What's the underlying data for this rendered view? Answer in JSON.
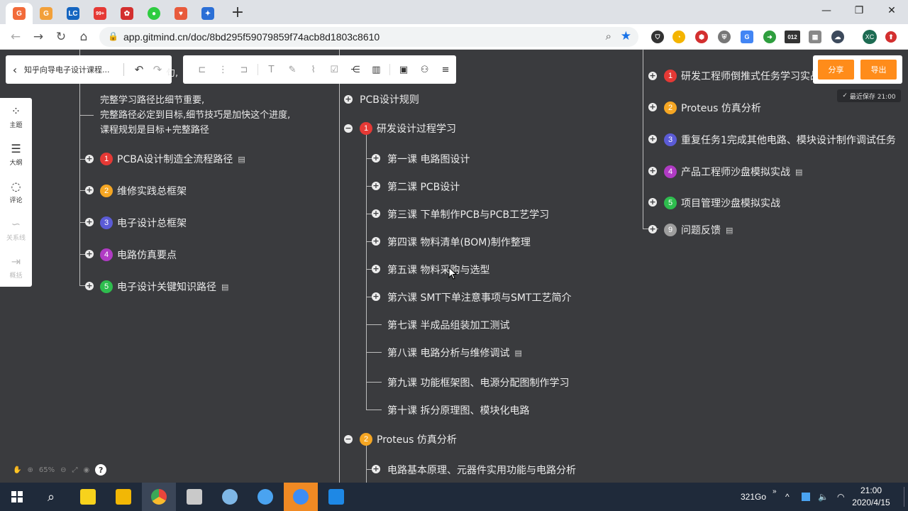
{
  "browser": {
    "tabs": [
      {
        "icon": "gitmind-icon",
        "color": "#f26b3a",
        "text": "",
        "active": true
      },
      {
        "icon": "gitmind-icon",
        "color": "#f2a03a",
        "text": "",
        "active": false
      },
      {
        "icon": "leetcode-icon",
        "color": "#1565c0",
        "text": "LC",
        "active": false
      },
      {
        "icon": "app-99-icon",
        "color": "#e53935",
        "text": "99+",
        "active": false
      },
      {
        "icon": "octopus-icon",
        "color": "#d32f2f",
        "text": "",
        "active": false
      },
      {
        "icon": "wechat-icon",
        "color": "#2ecc40",
        "text": "",
        "active": false
      },
      {
        "icon": "zhihu-icon",
        "color": "#e85a3c",
        "text": "",
        "active": false
      },
      {
        "icon": "baidu-icon",
        "color": "#2b6fd6",
        "text": "",
        "active": false
      }
    ],
    "url": "app.gitmind.cn/doc/8bd295f59079859f74acb8d1803c8610",
    "profile_initials": "XC",
    "ext_badge": "012"
  },
  "doc_toolbar": {
    "title": "知乎向导电子设计课程...",
    "hidden_text": "句,"
  },
  "actions": {
    "share_label": "分享",
    "export_label": "导出",
    "saved_status": "最近保存 21:00"
  },
  "sidebar": {
    "items": [
      {
        "label": "主题",
        "icon": "grid-icon",
        "enabled": true
      },
      {
        "label": "大纲",
        "icon": "list-icon",
        "enabled": true
      },
      {
        "label": "评论",
        "icon": "comment-icon",
        "enabled": true
      },
      {
        "label": "关系线",
        "icon": "relation-icon",
        "enabled": false
      },
      {
        "label": "概括",
        "icon": "summary-icon",
        "enabled": false
      }
    ]
  },
  "zoom_level": "65%",
  "mindmap": {
    "left_description": [
      "完整学习路径比细节重要,",
      "完整路径必定到目标,细节技巧是加快这个进度,",
      "课程规划是目标+完整路径"
    ],
    "left_nodes": [
      {
        "num": "1",
        "color": "#e53935",
        "label": "PCBA设计制造全流程路径",
        "note": true
      },
      {
        "num": "2",
        "color": "#f5a623",
        "label": "维修实践总框架",
        "note": false
      },
      {
        "num": "3",
        "color": "#5b5bd6",
        "label": "电子设计总框架",
        "note": false
      },
      {
        "num": "4",
        "color": "#b03bc4",
        "label": "电路仿真要点",
        "note": false
      },
      {
        "num": "5",
        "color": "#2ebd4e",
        "label": "电子设计关键知识路径",
        "note": true
      }
    ],
    "center_root_label": "PCB设计规则",
    "center_section_1": {
      "num": "1",
      "color": "#e53935",
      "label": "研发设计过程学习"
    },
    "lessons": [
      {
        "label": "第一课 电路图设计",
        "expandable": true,
        "note": false
      },
      {
        "label": "第二课 PCB设计",
        "expandable": true,
        "note": false
      },
      {
        "label": "第三课  下单制作PCB与PCB工艺学习",
        "expandable": true,
        "note": false
      },
      {
        "label": "第四课 物料清单(BOM)制作整理",
        "expandable": true,
        "note": false
      },
      {
        "label": "第五课 物料采购与选型",
        "expandable": true,
        "note": false
      },
      {
        "label": "第六课 SMT下单注意事项与SMT工艺简介",
        "expandable": true,
        "note": false
      },
      {
        "label": "第七课 半成品组装加工测试",
        "expandable": false,
        "note": false
      },
      {
        "label": "第八课  电路分析与维修调试",
        "expandable": false,
        "note": true
      },
      {
        "label": "第九课 功能框架图、电源分配图制作学习",
        "expandable": false,
        "note": false
      },
      {
        "label": "第十课 拆分原理图、模块化电路",
        "expandable": false,
        "note": false
      }
    ],
    "center_section_2": {
      "num": "2",
      "color": "#f5a623",
      "label": "Proteus 仿真分析"
    },
    "center_section_2_child": "电路基本原理、元器件实用功能与电路分析",
    "right_nodes": [
      {
        "num": "1",
        "color": "#e53935",
        "label": "研发工程师倒推式任务学习实战",
        "note": false
      },
      {
        "num": "2",
        "color": "#f5a623",
        "label": "Proteus 仿真分析",
        "note": false
      },
      {
        "num": "3",
        "color": "#5b5bd6",
        "label": "重复任务1完成其他电路、模块设计制作调试任务",
        "note": false
      },
      {
        "num": "4",
        "color": "#b03bc4",
        "label": "产品工程师沙盘模拟实战",
        "note": true
      },
      {
        "num": "5",
        "color": "#2ebd4e",
        "label": "项目管理沙盘模拟实战",
        "note": false
      },
      {
        "num": "9",
        "color": "#9e9e9e",
        "label": "问题反馈",
        "note": true
      }
    ]
  },
  "taskbar": {
    "apps": [
      {
        "icon": "sticky-notes-icon",
        "color": "#f7d21c"
      },
      {
        "icon": "file-explorer-icon",
        "color": "#f2b705"
      },
      {
        "icon": "chrome-icon",
        "color": "#e8453c"
      },
      {
        "icon": "book-app-icon",
        "color": "#c9c9c9"
      },
      {
        "icon": "spider-app-icon",
        "color": "#7fb7e6"
      },
      {
        "icon": "screen-recorder-icon",
        "color": "#4aa3f0"
      },
      {
        "icon": "feishu-icon",
        "color": "#3d8df5"
      },
      {
        "icon": "calendar-app-icon",
        "color": "#1e88e5"
      }
    ],
    "tray_text": "321Go",
    "time": "21:00",
    "date": "2020/4/15"
  }
}
